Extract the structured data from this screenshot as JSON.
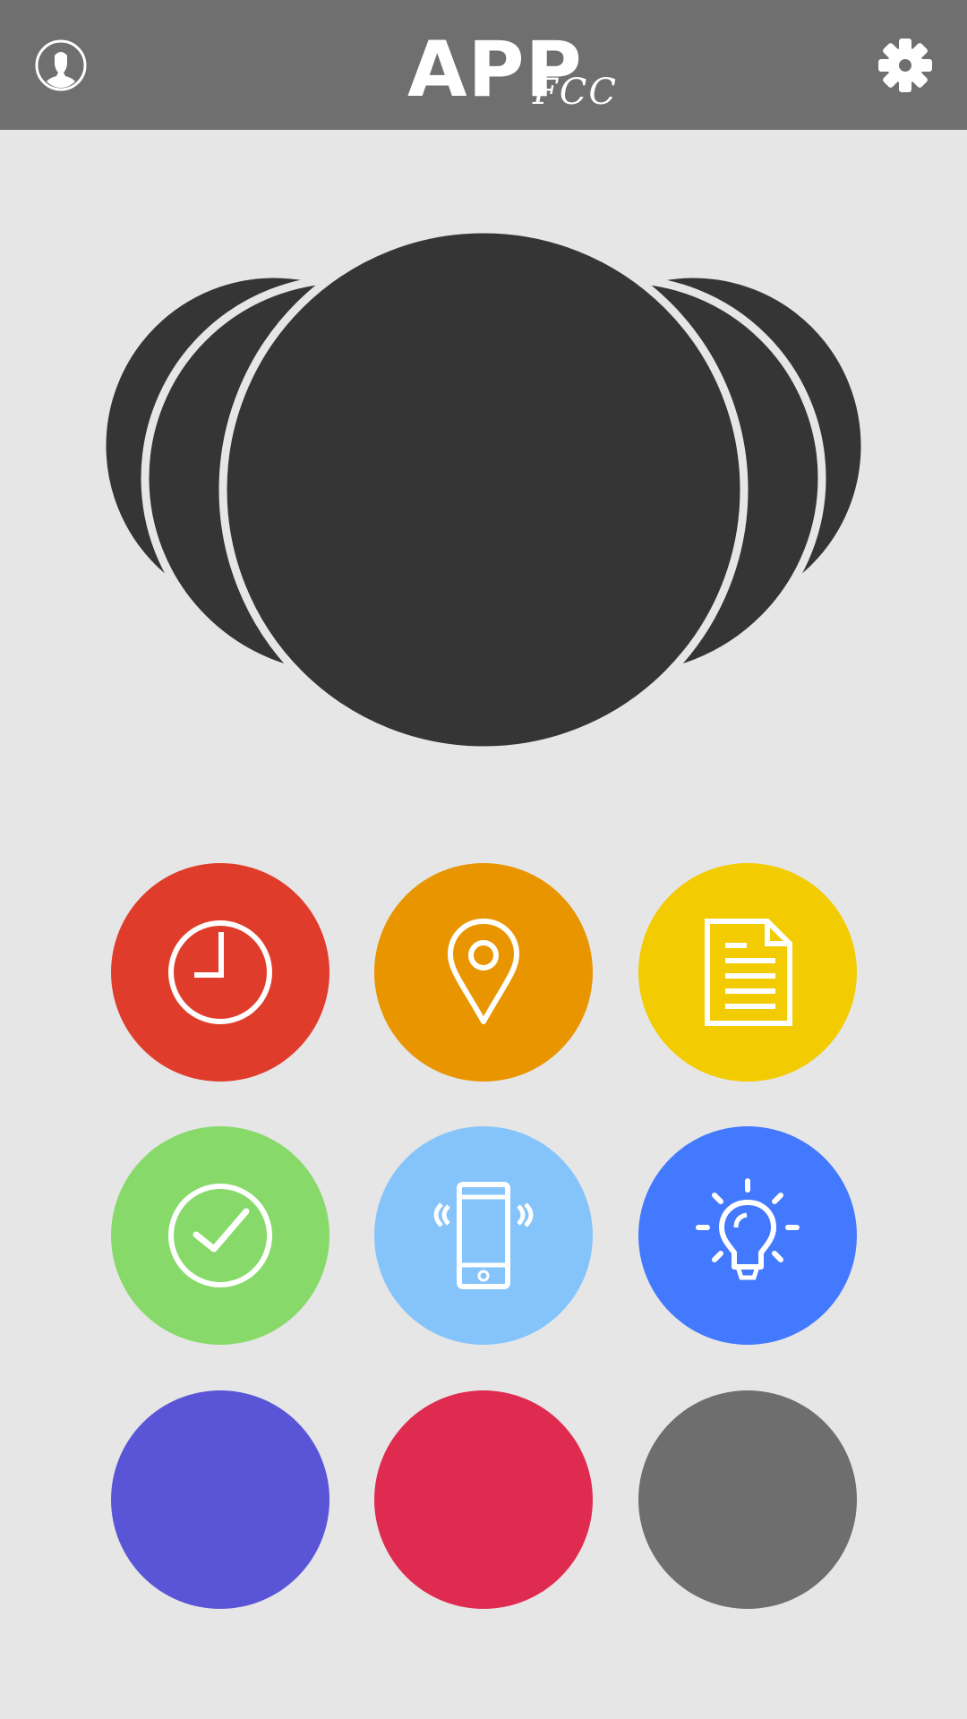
{
  "app": {
    "title_main": "APP",
    "title_sub": "FCC"
  },
  "header": {
    "profile_icon": "user-profile-icon",
    "settings_icon": "gear-icon",
    "background": "#6f6f6f"
  },
  "carousel": {
    "item_count": 5,
    "active_index": 2,
    "card_color": "#353535"
  },
  "grid": {
    "buttons": [
      {
        "name": "clock",
        "icon": "clock-icon",
        "color": "#e03c2b"
      },
      {
        "name": "location",
        "icon": "location-pin-icon",
        "color": "#e89500"
      },
      {
        "name": "document",
        "icon": "document-icon",
        "color": "#f2cc00"
      },
      {
        "name": "check",
        "icon": "check-circle-icon",
        "color": "#87da6a"
      },
      {
        "name": "phone",
        "icon": "vibrating-phone-icon",
        "color": "#85c4fa"
      },
      {
        "name": "idea",
        "icon": "lightbulb-icon",
        "color": "#4279fe"
      },
      {
        "name": "purple",
        "icon": "",
        "color": "#5a55d6"
      },
      {
        "name": "crimson",
        "icon": "",
        "color": "#e02b50"
      },
      {
        "name": "gray",
        "icon": "",
        "color": "#6e6e6e"
      }
    ]
  }
}
